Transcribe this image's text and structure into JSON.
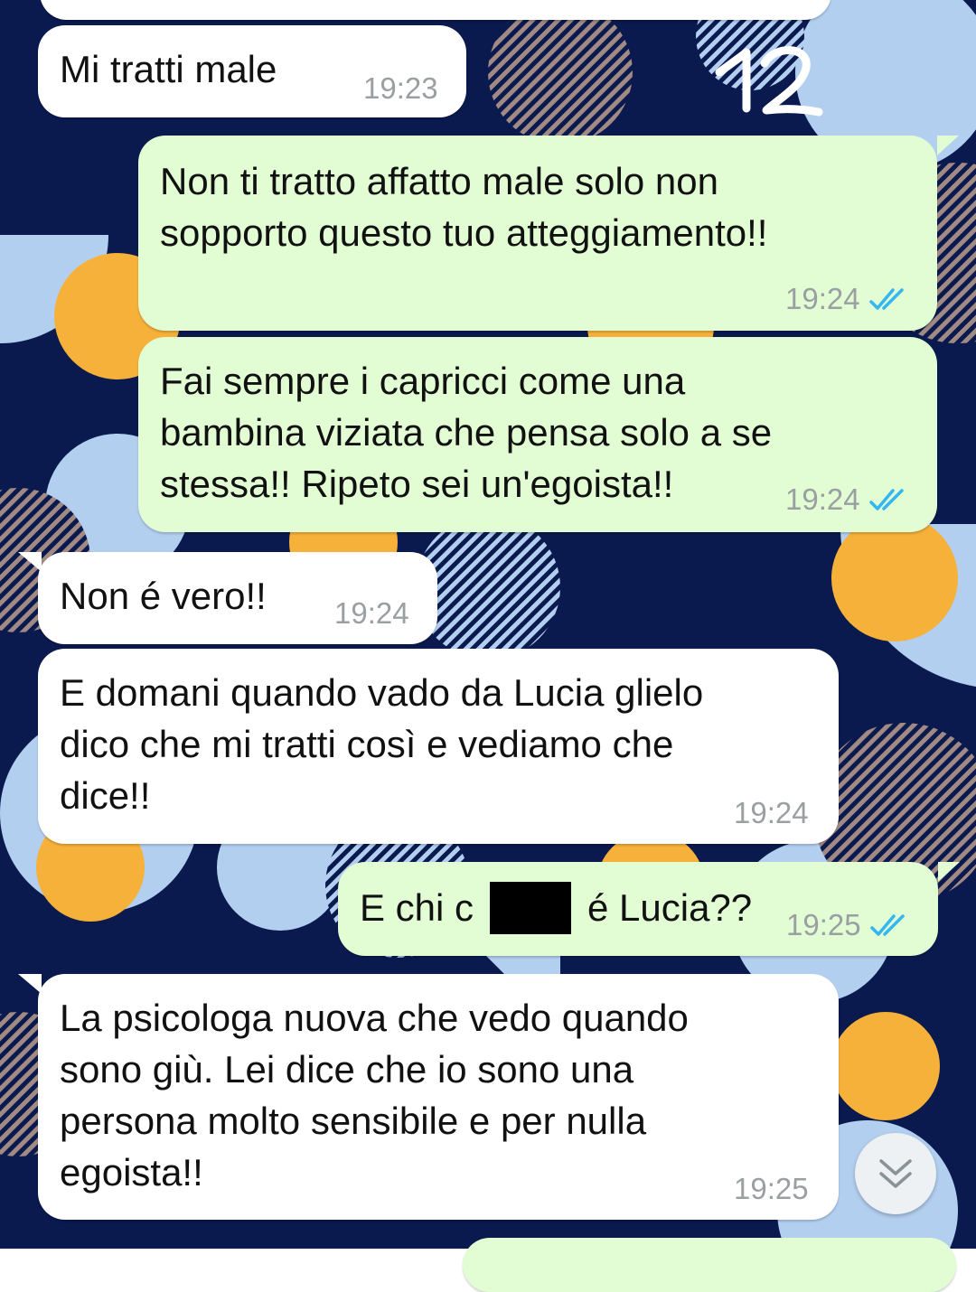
{
  "annotation": "12",
  "messages": [
    {
      "direction": "incoming",
      "text": "Mi tratti male",
      "time": "19:23"
    },
    {
      "direction": "outgoing",
      "lines": [
        "Non ti tratto affatto male solo non",
        "sopporto questo tuo atteggiamento!!"
      ],
      "time": "19:24",
      "status": "read"
    },
    {
      "direction": "outgoing",
      "lines": [
        "Fai sempre i capricci come una",
        "bambina viziata che pensa solo a se",
        "stessa!! Ripeto sei un'egoista!!"
      ],
      "time": "19:24",
      "status": "read"
    },
    {
      "direction": "incoming",
      "text": "Non é vero!!",
      "time": "19:24"
    },
    {
      "direction": "incoming",
      "lines": [
        "E domani quando vado da Lucia glielo",
        "dico che mi tratti così e vediamo che",
        "dice!!"
      ],
      "time": "19:24"
    },
    {
      "direction": "outgoing",
      "text_before": "E chi c",
      "text_after": "é Lucia??",
      "time": "19:25",
      "status": "read"
    },
    {
      "direction": "incoming",
      "lines": [
        "La psicologa nuova che vedo quando",
        "sono giù. Lei dice che io sono una",
        "persona molto sensibile e per nulla",
        "egoista!!"
      ],
      "time": "19:25"
    }
  ],
  "icons": {
    "read_receipt": "double-check-icon",
    "scroll_down": "chevron-double-down-icon"
  },
  "colors": {
    "wallpaper": "#0a1a4f",
    "incoming_bubble": "#ffffff",
    "outgoing_bubble": "#e2fdd4",
    "tick_blue": "#34b7f1",
    "orange": "#f6b13a",
    "light_blue": "#b3cff0"
  }
}
